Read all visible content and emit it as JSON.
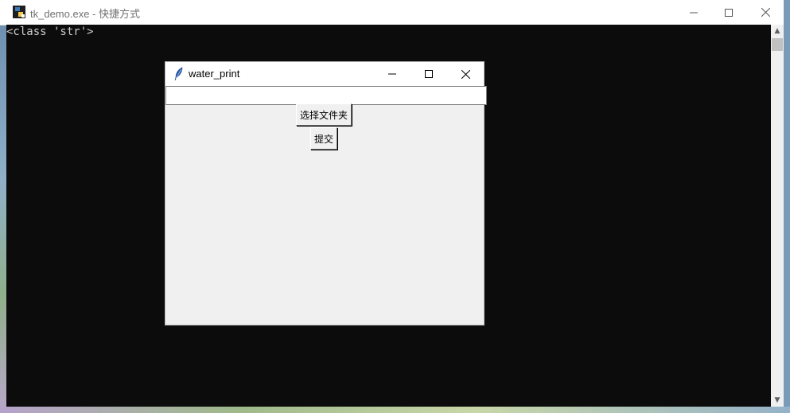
{
  "console": {
    "title": "tk_demo.exe - 快捷方式",
    "output": "<class 'str'>"
  },
  "app": {
    "title": "water_print",
    "entry_value": "",
    "select_folder_label": "选择文件夹",
    "submit_label": "提交"
  }
}
